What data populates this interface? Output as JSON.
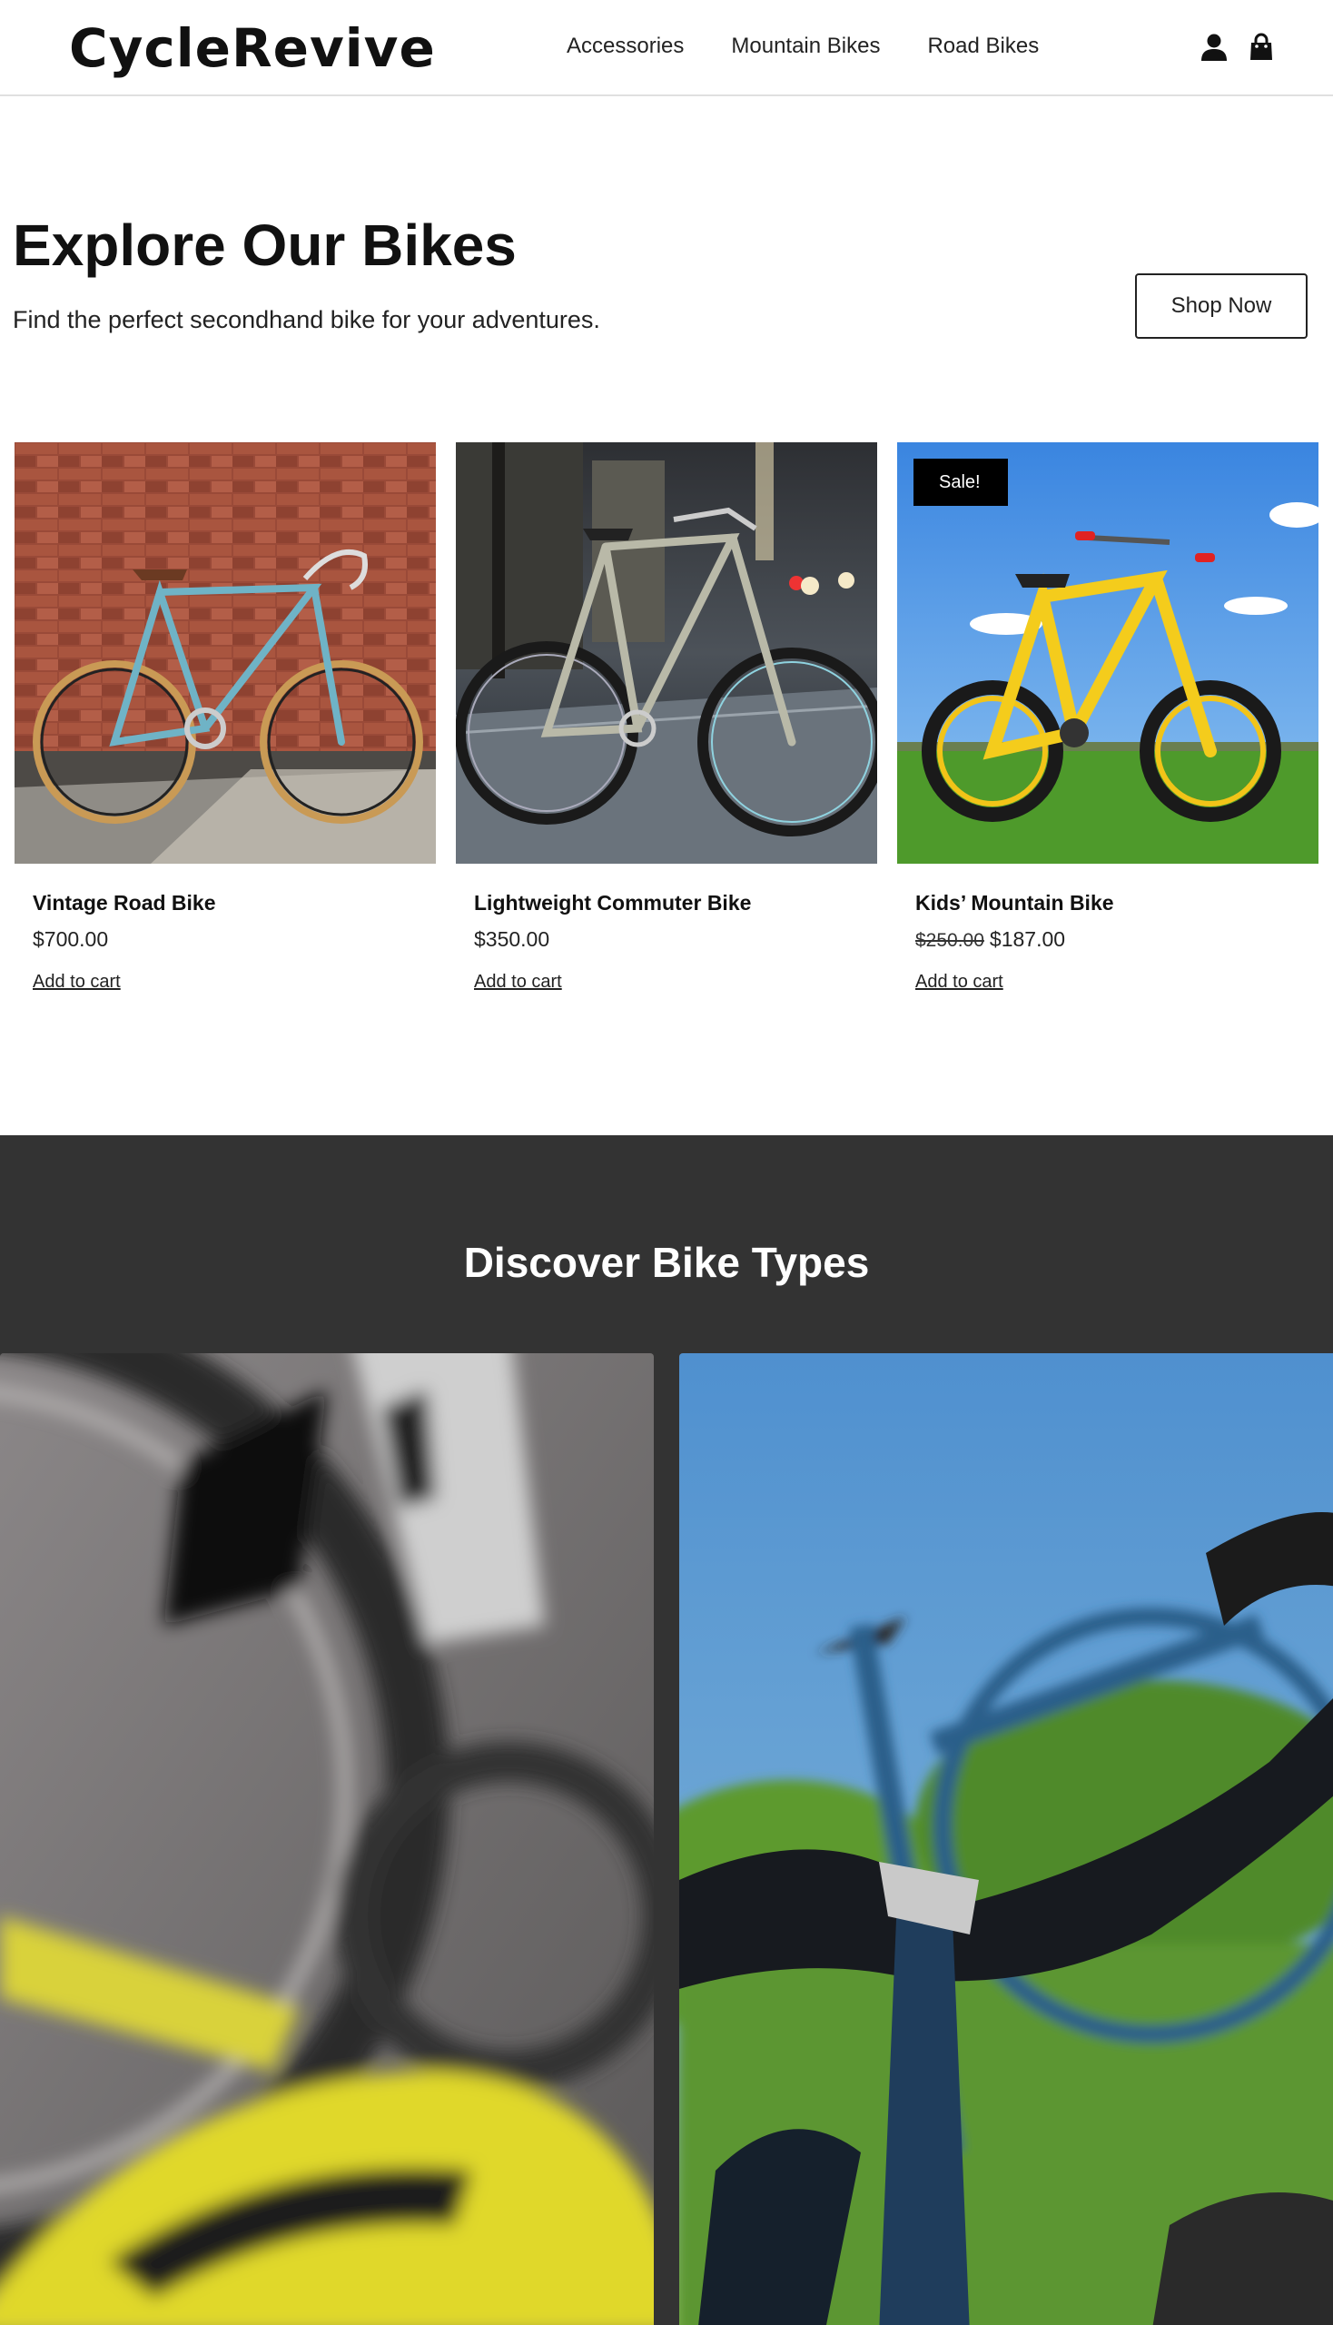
{
  "header": {
    "logo": "CycleRevive",
    "nav": [
      "Accessories",
      "Mountain Bikes",
      "Road Bikes"
    ],
    "icons": [
      "user-icon",
      "shopping-bag-icon"
    ]
  },
  "hero": {
    "title": "Explore Our Bikes",
    "subtitle": "Find the perfect secondhand bike for your adventures.",
    "cta": "Shop Now"
  },
  "products": [
    {
      "name": "Vintage Road Bike",
      "price": "$700.00",
      "old_price": null,
      "badge": null,
      "cart": "Add to cart"
    },
    {
      "name": "Lightweight Commuter Bike",
      "price": "$350.00",
      "old_price": null,
      "badge": null,
      "cart": "Add to cart"
    },
    {
      "name": "Kids’ Mountain Bike",
      "price": "$187.00",
      "old_price": "$250.00",
      "badge": "Sale!",
      "cart": "Add to cart"
    }
  ],
  "discover": {
    "title": "Discover Bike Types"
  },
  "colors": {
    "dark_section": "#333333",
    "sale_badge": "#000000"
  }
}
